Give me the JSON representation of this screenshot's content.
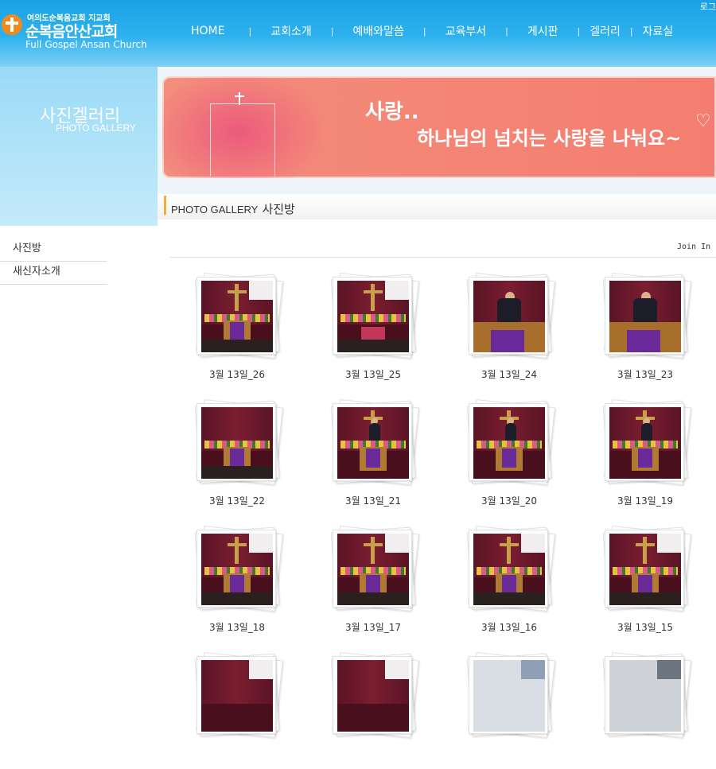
{
  "header": {
    "logo_sub": "여의도순복음교회 지교회",
    "logo_main": "순복음안산교회",
    "logo_eng": "Full Gospel Ansan Church",
    "login": "로그",
    "nav": [
      "HOME",
      "교회소개",
      "예배와말씀",
      "교육부서",
      "게시판",
      "겔러리",
      "자료실"
    ],
    "nav_sep": "|"
  },
  "side": {
    "title": "사진겔러리",
    "subtitle": "PHOTO GALLERY",
    "menu": [
      "사진방",
      "새신자소개"
    ]
  },
  "banner": {
    "line1": "사랑..",
    "line2": "하나님의 넘치는 사랑을 나눠요~"
  },
  "section": {
    "title_en": "PHOTO GALLERY",
    "title_ko": "사진방"
  },
  "toolbar": {
    "join": "Join  In"
  },
  "gallery": [
    {
      "caption": "3월 13일_26"
    },
    {
      "caption": "3월 13일_25"
    },
    {
      "caption": "3월 13일_24"
    },
    {
      "caption": "3월 13일_23"
    },
    {
      "caption": "3월 13일_22"
    },
    {
      "caption": "3월 13일_21"
    },
    {
      "caption": "3월 13일_20"
    },
    {
      "caption": "3월 13일_19"
    },
    {
      "caption": "3월 13일_18"
    },
    {
      "caption": "3월 13일_17"
    },
    {
      "caption": "3월 13일_16"
    },
    {
      "caption": "3월 13일_15"
    },
    {
      "caption": ""
    },
    {
      "caption": ""
    },
    {
      "caption": ""
    },
    {
      "caption": ""
    }
  ],
  "colors": {
    "header_blue": "#1aa0e6",
    "banner_pink": "#f38e7c",
    "accent_orange": "#f08a1c",
    "section_bar": "#f0b030"
  }
}
